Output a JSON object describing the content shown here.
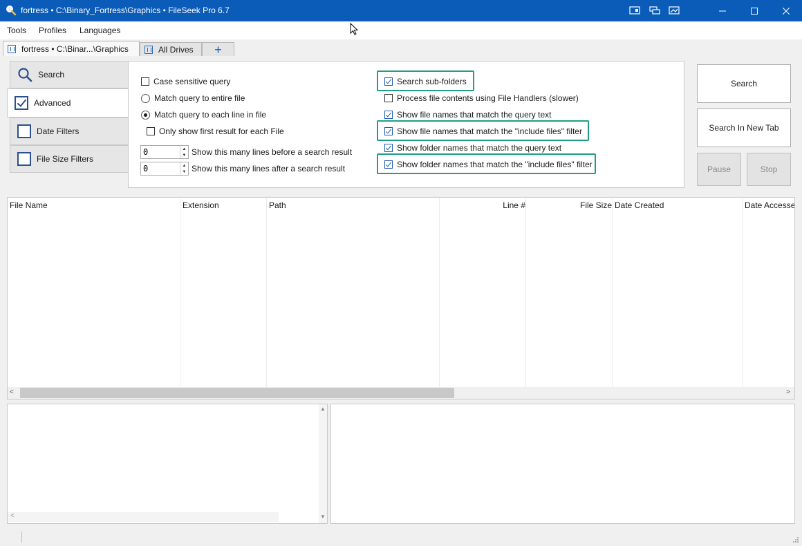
{
  "window": {
    "title": "fortress • C:\\Binary_Fortress\\Graphics • FileSeek Pro 6.7"
  },
  "menu": [
    "Tools",
    "Profiles",
    "Languages"
  ],
  "tabs": [
    {
      "label": "fortress • C:\\Binar...\\Graphics",
      "active": true
    },
    {
      "label": "All Drives",
      "active": false
    }
  ],
  "new_tab_label": "+",
  "side_tabs": [
    {
      "label": "Search",
      "icon": "magnifier-icon"
    },
    {
      "label": "Advanced",
      "checked": true
    },
    {
      "label": "Date Filters",
      "checked": false
    },
    {
      "label": "File Size Filters",
      "checked": false
    }
  ],
  "options": {
    "case_sensitive": {
      "label": "Case sensitive query",
      "checked": false
    },
    "match_entire": {
      "label": "Match query to entire file",
      "selected": false
    },
    "match_line": {
      "label": "Match query to each line in file",
      "selected": true
    },
    "first_result": {
      "label": "Only show first result for each File",
      "checked": false
    },
    "lines_before": {
      "label": "Show this many lines before a search result",
      "value": "0"
    },
    "lines_after": {
      "label": "Show this many lines after a search result",
      "value": "0"
    },
    "sub_folders": {
      "label": "Search sub-folders",
      "checked": true
    },
    "file_handlers": {
      "label": "Process file contents using File Handlers (slower)",
      "checked": false
    },
    "file_names_query": {
      "label": "Show file names that match the query text",
      "checked": true
    },
    "file_names_include": {
      "label": "Show file names that match the \"include files\" filter",
      "checked": true
    },
    "folder_names_query": {
      "label": "Show folder names that match the query text",
      "checked": true
    },
    "folder_names_include": {
      "label": "Show folder names that match the \"include files\" filter",
      "checked": true
    }
  },
  "buttons": {
    "search": "Search",
    "search_new_tab": "Search In New Tab",
    "pause": "Pause",
    "stop": "Stop"
  },
  "results": {
    "columns": [
      "File Name",
      "Extension",
      "Path",
      "Line #",
      "File Size",
      "Date Created",
      "Date Accessed"
    ]
  },
  "colors": {
    "titlebar": "#0b5cb8",
    "highlight": "#1e9e84"
  }
}
